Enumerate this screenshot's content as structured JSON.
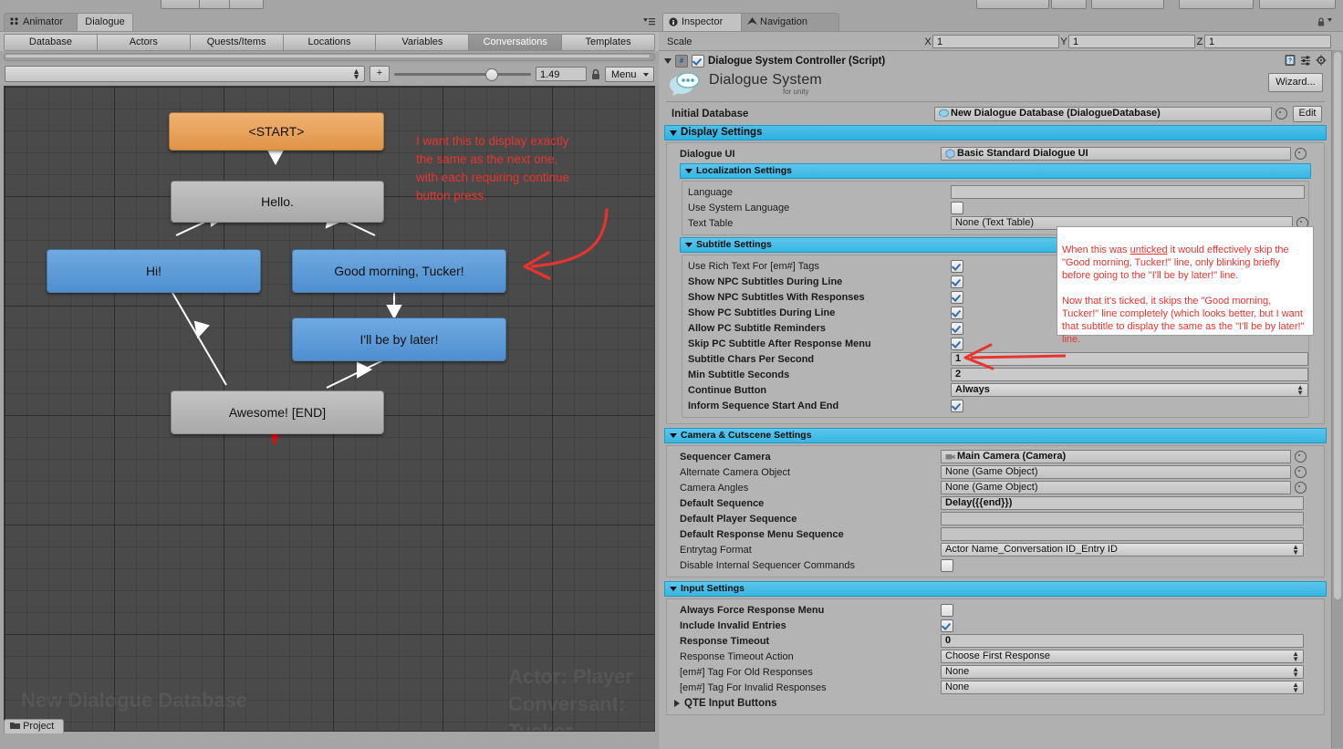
{
  "window": {
    "tabs": [
      {
        "label": "Animator",
        "icon": "animator-icon",
        "active": false
      },
      {
        "label": "Dialogue",
        "icon": "",
        "active": true
      }
    ],
    "pane_menu_icon": "pane-options-icon"
  },
  "database_tabs": [
    {
      "label": "Database",
      "selected": false
    },
    {
      "label": "Actors",
      "selected": false
    },
    {
      "label": "Quests/Items",
      "selected": false
    },
    {
      "label": "Locations",
      "selected": false
    },
    {
      "label": "Variables",
      "selected": false
    },
    {
      "label": "Conversations",
      "selected": true
    },
    {
      "label": "Templates",
      "selected": false
    }
  ],
  "toolbar": {
    "conversation_value": "",
    "add_label": "+",
    "zoom_value": "1.49",
    "lock_icon": "lock-icon",
    "menu_label": "Menu"
  },
  "canvas": {
    "nodes": [
      {
        "id": "start",
        "label": "<START>",
        "type": "start"
      },
      {
        "id": "hello",
        "label": "Hello.",
        "type": "npc"
      },
      {
        "id": "hi",
        "label": "Hi!",
        "type": "pc"
      },
      {
        "id": "goodmorning",
        "label": "Good morning, Tucker!",
        "type": "pc"
      },
      {
        "id": "later",
        "label": "I'll be by later!",
        "type": "pc"
      },
      {
        "id": "awesome",
        "label": "Awesome! [END]",
        "type": "npc"
      }
    ],
    "annotation": "I want this to display exactly\nthe same as the next one,\nwith each requiring continue\nbutton press.",
    "watermark_left": "New Dialogue Database",
    "watermark_right": "Actor: Player\nConversant: Tucker",
    "colors": {
      "start": "#e6a055",
      "npc": "#b5b5b5",
      "pc": "#5b9bd8",
      "annotation": "#e8342f",
      "background": "#4a4a4a"
    }
  },
  "project_tab": {
    "label": "Project",
    "icon": "folder-icon"
  },
  "inspector": {
    "tabs": [
      {
        "label": "Inspector",
        "icon": "info-icon",
        "active": true
      },
      {
        "label": "Navigation",
        "icon": "navigation-icon",
        "active": false
      }
    ],
    "lock_icon": "lock-icon",
    "menu_icon": "pane-options-icon",
    "transform_scale": {
      "label": "Scale",
      "axes": [
        {
          "axis": "X",
          "value": "1"
        },
        {
          "axis": "Y",
          "value": "1"
        },
        {
          "axis": "Z",
          "value": "1"
        }
      ]
    },
    "component": {
      "title": "Dialogue System Controller (Script)",
      "enabled": true,
      "script_icon": "cs-script-icon",
      "header_icons": [
        "help-icon",
        "preset-icon",
        "gear-icon"
      ],
      "logo_title": "Dialogue System",
      "logo_subtitle": "for unity",
      "wizard_label": "Wizard..."
    },
    "initial_database": {
      "label": "Initial Database",
      "value": "New Dialogue Database (DialogueDatabase)",
      "edit_label": "Edit",
      "picker_icon": "object-picker-icon"
    },
    "display_settings": {
      "title": "Display Settings",
      "dialogue_ui": {
        "label": "Dialogue UI",
        "value": "Basic Standard Dialogue UI"
      },
      "localization": {
        "title": "Localization Settings",
        "rows": [
          {
            "label": "Language",
            "type": "text",
            "value": ""
          },
          {
            "label": "Use System Language",
            "type": "checkbox",
            "checked": false
          },
          {
            "label": "Text Table",
            "type": "object",
            "value": "None (Text Table)"
          }
        ]
      },
      "subtitle": {
        "title": "Subtitle Settings",
        "rows": [
          {
            "label": "Use Rich Text For [em#] Tags",
            "type": "checkbox",
            "checked": true,
            "bold": false
          },
          {
            "label": "Show NPC Subtitles During Line",
            "type": "checkbox",
            "checked": true,
            "bold": true
          },
          {
            "label": "Show NPC Subtitles With Responses",
            "type": "checkbox",
            "checked": true,
            "bold": true
          },
          {
            "label": "Show PC Subtitles During Line",
            "type": "checkbox",
            "checked": true,
            "bold": true
          },
          {
            "label": "Allow PC Subtitle Reminders",
            "type": "checkbox",
            "checked": true,
            "bold": true
          },
          {
            "label": "Skip PC Subtitle After Response Menu",
            "type": "checkbox",
            "checked": true,
            "bold": true
          },
          {
            "label": "Subtitle Chars Per Second",
            "type": "text",
            "value": "1",
            "bold": true
          },
          {
            "label": "Min Subtitle Seconds",
            "type": "text",
            "value": "2",
            "bold": true
          },
          {
            "label": "Continue Button",
            "type": "popup",
            "value": "Always",
            "bold": true
          },
          {
            "label": "Inform Sequence Start And End",
            "type": "checkbox",
            "checked": true,
            "bold": true
          }
        ]
      }
    },
    "camera_settings": {
      "title": "Camera & Cutscene Settings",
      "rows": [
        {
          "label": "Sequencer Camera",
          "type": "object",
          "value": "Main Camera (Camera)",
          "bold": true
        },
        {
          "label": "Alternate Camera Object",
          "type": "object",
          "value": "None (Game Object)",
          "bold": false
        },
        {
          "label": "Camera Angles",
          "type": "object",
          "value": "None (Game Object)",
          "bold": false
        },
        {
          "label": "Default Sequence",
          "type": "text",
          "value": "Delay({{end}})",
          "bold": true
        },
        {
          "label": "Default Player Sequence",
          "type": "text",
          "value": "",
          "bold": true
        },
        {
          "label": "Default Response Menu Sequence",
          "type": "text",
          "value": "",
          "bold": true
        },
        {
          "label": "Entrytag Format",
          "type": "popup",
          "value": "Actor Name_Conversation ID_Entry ID",
          "bold": false
        },
        {
          "label": "Disable Internal Sequencer Commands",
          "type": "checkbox",
          "checked": false,
          "bold": false
        }
      ]
    },
    "input_settings": {
      "title": "Input Settings",
      "rows": [
        {
          "label": "Always Force Response Menu",
          "type": "checkbox",
          "checked": false,
          "bold": true
        },
        {
          "label": "Include Invalid Entries",
          "type": "checkbox",
          "checked": true,
          "bold": true
        },
        {
          "label": "Response Timeout",
          "type": "text",
          "value": "0",
          "bold": true
        },
        {
          "label": "Response Timeout Action",
          "type": "popup",
          "value": "Choose First Response",
          "bold": false
        },
        {
          "label": "[em#] Tag For Old Responses",
          "type": "popup",
          "value": "None",
          "bold": false
        },
        {
          "label": "[em#] Tag For Invalid Responses",
          "type": "popup",
          "value": "None",
          "bold": false
        }
      ],
      "qte": {
        "label": "QTE Input Buttons",
        "expanded": false
      }
    },
    "annotation": "When this was unticked it would effectively skip the \"Good morning, Tucker!\" line, only blinking briefly before going to the \"I'll be by later!\" line.\n\nNow that it's ticked, it skips the \"Good morning, Tucker!\" line completely (which looks better, but I want that subtitle to display the same as the \"I'll be by later!\" line."
  }
}
